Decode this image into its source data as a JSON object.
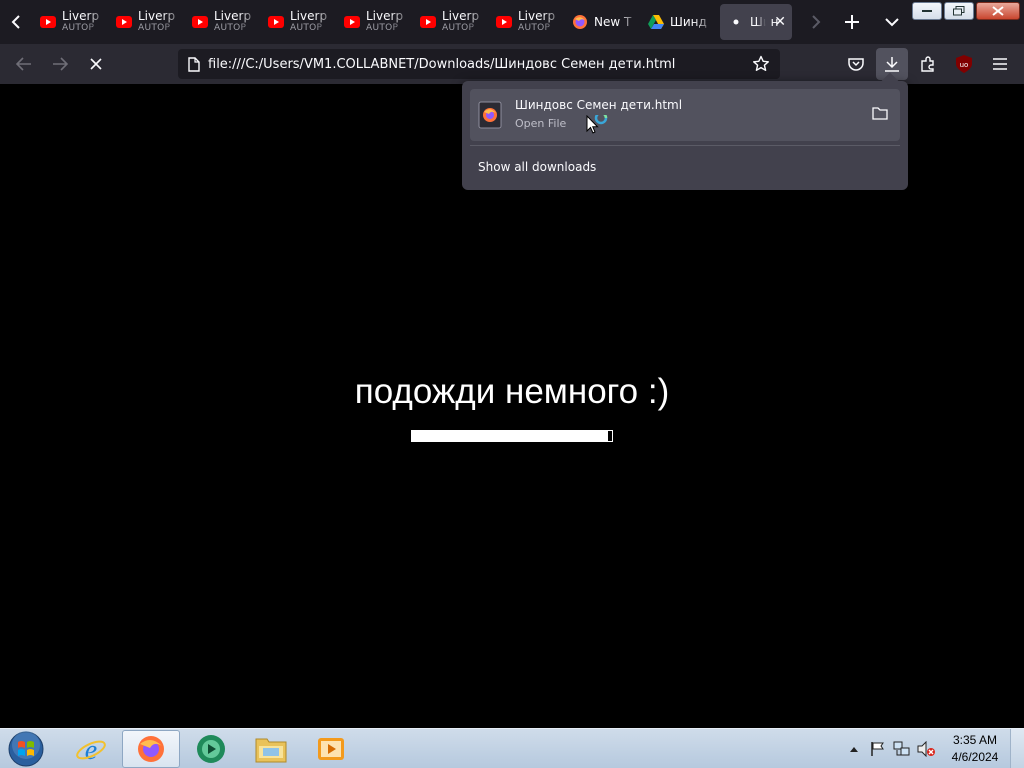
{
  "browser": {
    "tabs": [
      {
        "title": "Liverp",
        "subtitle": "AUTOP",
        "icon": "youtube-icon"
      },
      {
        "title": "Liverp",
        "subtitle": "AUTOP",
        "icon": "youtube-icon"
      },
      {
        "title": "Liverp",
        "subtitle": "AUTOP",
        "icon": "youtube-icon"
      },
      {
        "title": "Liverp",
        "subtitle": "AUTOP",
        "icon": "youtube-icon"
      },
      {
        "title": "Liverp",
        "subtitle": "AUTOP",
        "icon": "youtube-icon"
      },
      {
        "title": "Liverp",
        "subtitle": "AUTOP",
        "icon": "youtube-icon"
      },
      {
        "title": "Liverp",
        "subtitle": "AUTOP",
        "icon": "youtube-icon"
      },
      {
        "title": "New T",
        "icon": "firefox-icon"
      },
      {
        "title": "Шинд",
        "icon": "google-drive-icon"
      },
      {
        "title": "Шин",
        "icon": "loading-dot-icon",
        "active": true
      }
    ],
    "url": "file:///C:/Users/VM1.COLLABNET/Downloads/Шиндовс Семен дети.html"
  },
  "downloads_panel": {
    "file_name": "Шиндовс Семен дети.html",
    "status": "Open File",
    "show_all_label": "Show all downloads"
  },
  "page": {
    "message": "подожди немного :)",
    "progress": 0.98
  },
  "taskbar": {
    "apps": [
      "internet-explorer-icon",
      "firefox-icon",
      "media-center-icon",
      "explorer-icon",
      "media-player-icon"
    ],
    "clock": {
      "time": "3:35 AM",
      "date": "4/6/2024"
    }
  },
  "colors": {
    "tabstrip_bg": "#1c1b22",
    "toolbar_bg": "#2b2a33",
    "panel_bg": "#42414d",
    "youtube_red": "#ff0000",
    "ublock_red": "#800000"
  }
}
